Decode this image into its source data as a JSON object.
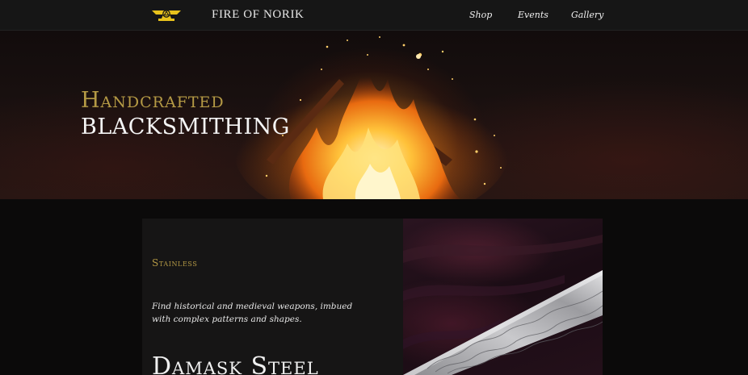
{
  "header": {
    "brand": "FIRE OF NORIK",
    "logo_icon": "anvil-logo-icon",
    "nav": [
      {
        "label": "Shop"
      },
      {
        "label": "Events"
      },
      {
        "label": "Gallery"
      }
    ]
  },
  "hero": {
    "title_line_1": "Handcrafted",
    "title_line_2": "BLACKSMITHING"
  },
  "product": {
    "tag": "Stainless",
    "description": "Find historical and medieval weapons, imbued with complex patterns and shapes.",
    "heading": "Damask Steel"
  },
  "colors": {
    "accent_gold": "#b59a45",
    "logo_yellow": "#e8c21c",
    "topbar": "#161616"
  }
}
